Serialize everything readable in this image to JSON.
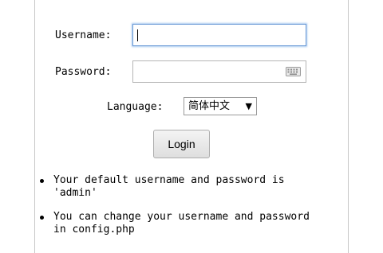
{
  "login_form": {
    "username_label": "Username:",
    "username_value": "",
    "password_label": "Password:",
    "password_value": "",
    "language_label": "Language:",
    "language_selected": "简体中文",
    "language_arrow": "▼",
    "login_button": "Login"
  },
  "notes": [
    "Your default username and password is 'admin'",
    "You can change your username and password in config.php"
  ],
  "icons": {
    "password_field_icon": "keyboard-icon",
    "dropdown_icon": "triangle-down-icon"
  }
}
